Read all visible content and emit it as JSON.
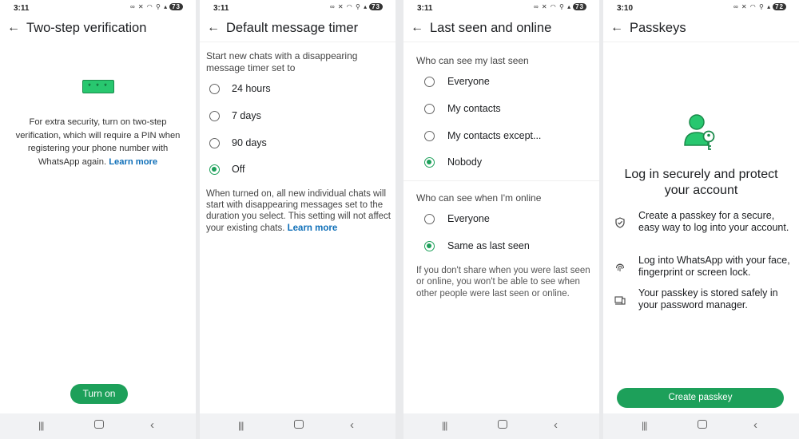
{
  "status_icons": "∞ ✕ ◠ ⚲ ▴",
  "panels": [
    {
      "time": "3:11",
      "battery": "73",
      "title": "Two-step verification",
      "pin_chars": "* * *",
      "description": "For extra security, turn on two-step verification, which will require a PIN when registering your phone number with WhatsApp again. ",
      "link": "Learn more",
      "button": "Turn on"
    },
    {
      "time": "3:11",
      "battery": "73",
      "title": "Default message timer",
      "section": "Start new chats with a disappearing message timer set to",
      "options": [
        {
          "label": "24 hours",
          "selected": false
        },
        {
          "label": "7 days",
          "selected": false
        },
        {
          "label": "90 days",
          "selected": false
        },
        {
          "label": "Off",
          "selected": true
        }
      ],
      "description": "When turned on, all new individual chats will start with disappearing messages set to the duration you select. This setting will not affect your existing chats. ",
      "link": "Learn more"
    },
    {
      "time": "3:11",
      "battery": "73",
      "title": "Last seen and online",
      "last_seen_header": "Who can see my last seen",
      "last_seen_options": [
        {
          "label": "Everyone",
          "selected": false
        },
        {
          "label": "My contacts",
          "selected": false
        },
        {
          "label": "My contacts except...",
          "selected": false
        },
        {
          "label": "Nobody",
          "selected": true
        }
      ],
      "online_header": "Who can see when I'm online",
      "online_options": [
        {
          "label": "Everyone",
          "selected": false
        },
        {
          "label": "Same as last seen",
          "selected": true
        }
      ],
      "description": "If you don't share when you were last seen or online, you won't be able to see when other people were last seen or online."
    },
    {
      "time": "3:10",
      "battery": "72",
      "title": "Passkeys",
      "heading": "Log in securely and protect your account",
      "features": [
        {
          "icon": "shield-check-icon",
          "text": "Create a passkey for a secure, easy way to log into your account."
        },
        {
          "icon": "fingerprint-icon",
          "text": "Log into WhatsApp with your face, fingerprint or screen lock."
        },
        {
          "icon": "devices-icon",
          "text": "Your passkey is stored safely in your password manager."
        }
      ],
      "button": "Create passkey"
    }
  ],
  "colors": {
    "accent": "#1da05a",
    "link": "#0f6fb8",
    "navbar": "#f1f2f4"
  }
}
